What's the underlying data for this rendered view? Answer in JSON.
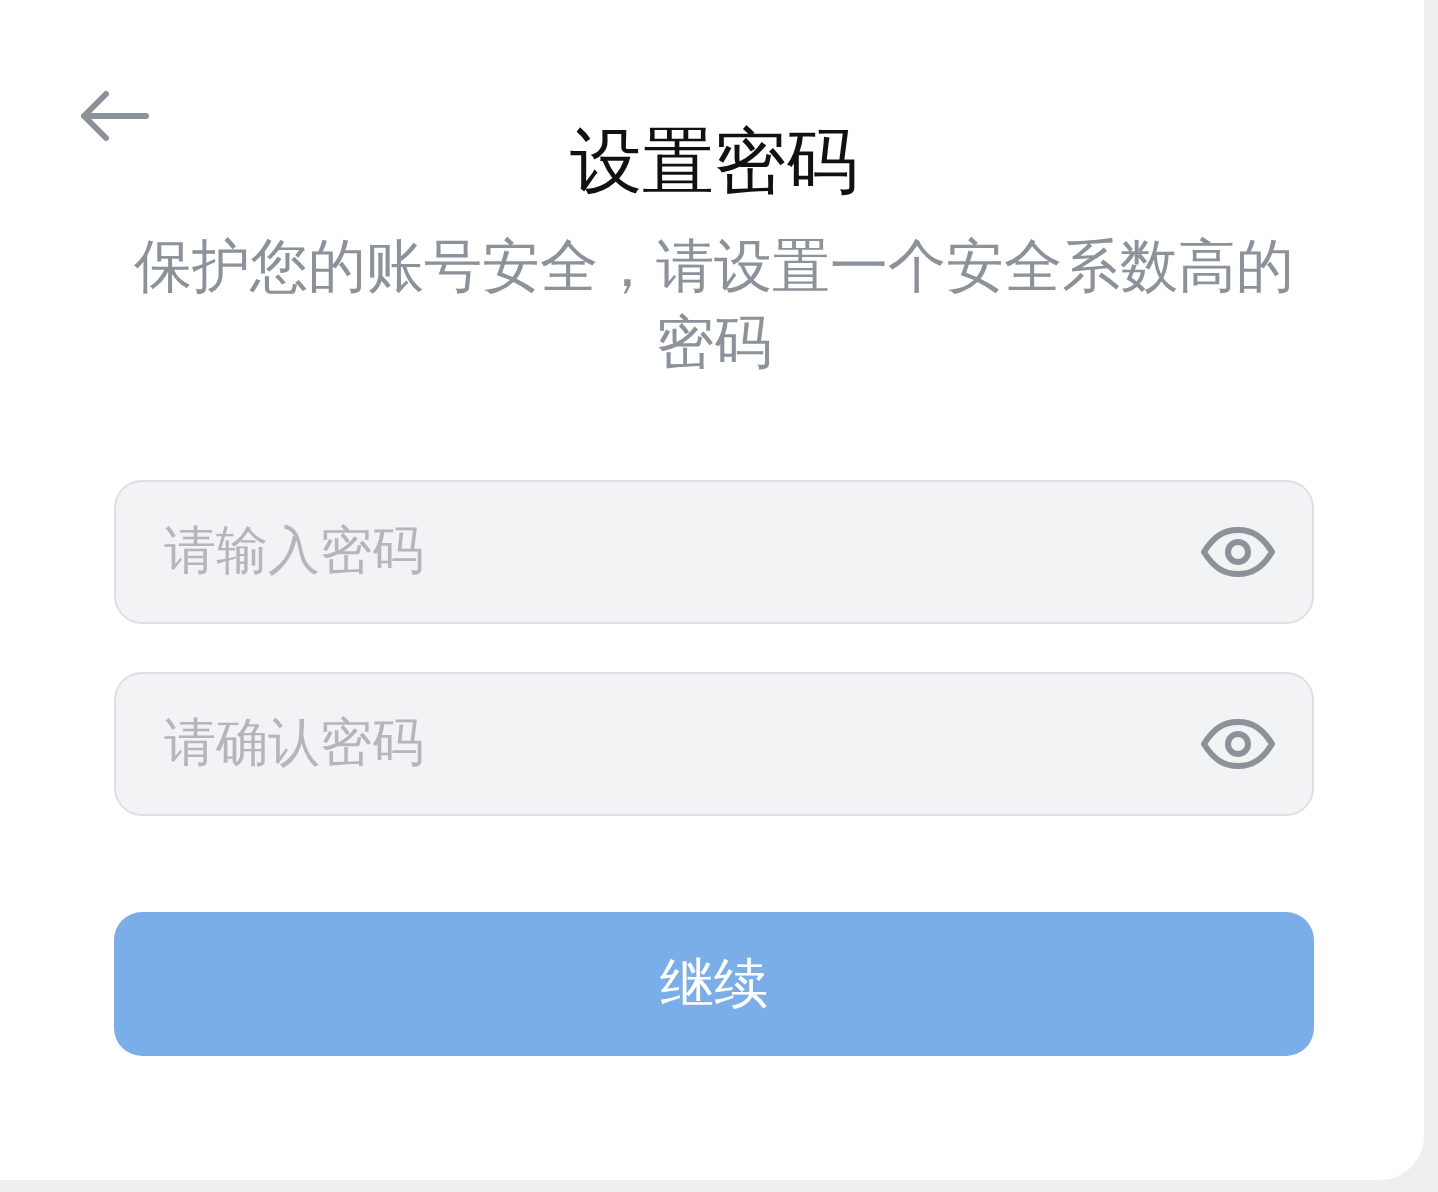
{
  "title": "设置密码",
  "subtitle": "保护您的账号安全，请设置一个安全系数高的密码",
  "fields": [
    {
      "placeholder": "请输入密码"
    },
    {
      "placeholder": "请确认密码"
    }
  ],
  "continue_button": {
    "label": "继续",
    "disabled": true
  }
}
